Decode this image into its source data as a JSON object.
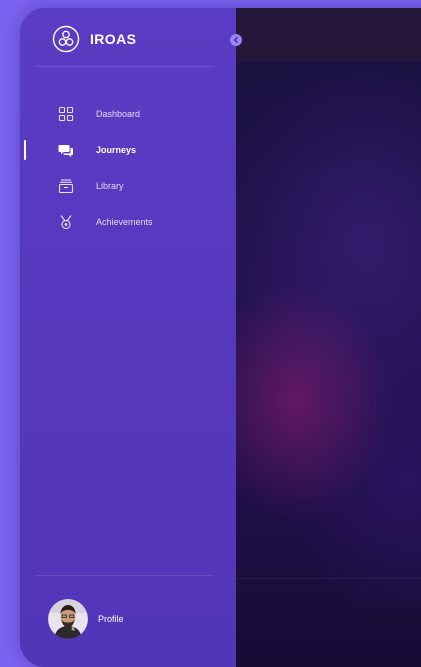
{
  "brand": {
    "name": "IROAS",
    "logo_icon": "iroas-logo-icon"
  },
  "sidebar": {
    "collapse_icon": "chevron-left-icon",
    "items": [
      {
        "label": "Dashboard",
        "icon": "grid-icon",
        "active": false
      },
      {
        "label": "Journeys",
        "icon": "chat-bubbles-icon",
        "active": true
      },
      {
        "label": "Library",
        "icon": "archive-box-icon",
        "active": false
      },
      {
        "label": "Achievements",
        "icon": "medal-icon",
        "active": false
      }
    ],
    "profile": {
      "label": "Profile",
      "icon": "avatar-photo"
    }
  },
  "colors": {
    "page_background": "#7b62f0",
    "sidebar": "#5638bd",
    "main_background": "#1a1140",
    "topbar": "#241638",
    "toggle": "#9a83f2"
  }
}
